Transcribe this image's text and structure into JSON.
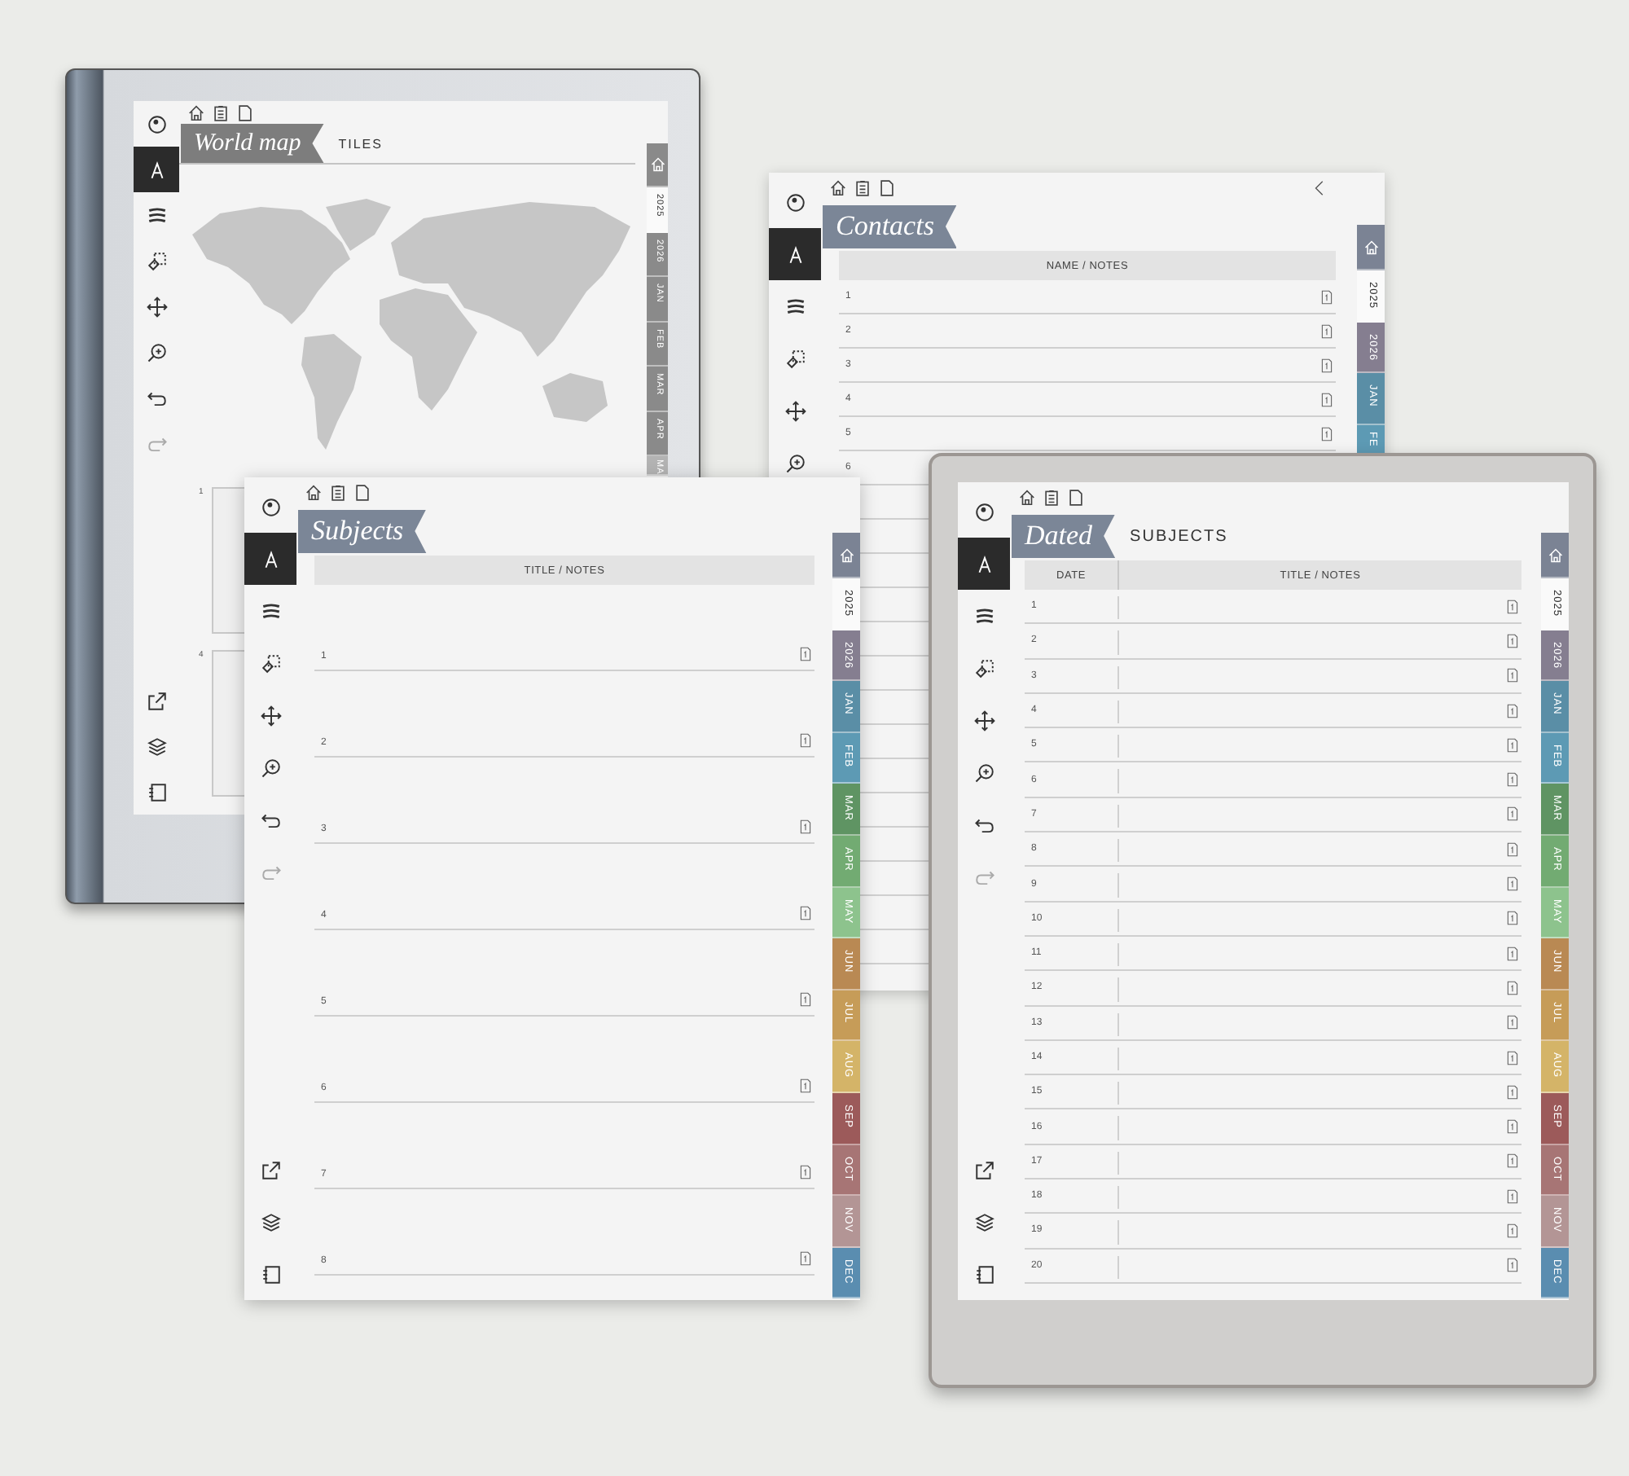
{
  "pages": [
    {
      "kind": "map",
      "title": "World map",
      "subtitle": "TILES",
      "tools": [
        {
          "kind": "dial",
          "selected": false
        },
        {
          "kind": "pen",
          "selected": true
        },
        {
          "kind": "lines",
          "selected": false
        },
        {
          "kind": "eraser",
          "selected": false
        },
        {
          "kind": "move",
          "selected": false
        },
        {
          "kind": "zoom",
          "selected": false
        },
        {
          "kind": "undo",
          "selected": false
        },
        {
          "kind": "redo",
          "selected": false
        }
      ],
      "bottom_tools": [
        {
          "kind": "export",
          "selected": false
        },
        {
          "kind": "layers",
          "selected": false
        },
        {
          "kind": "notebook",
          "selected": false
        }
      ],
      "tabs": [
        {
          "kind": "home",
          "selected": false,
          "color": "#8a8a8a"
        },
        {
          "kind": "label",
          "label": "2025",
          "selected": true,
          "color": "#333333"
        },
        {
          "kind": "label",
          "label": "2026",
          "selected": false,
          "color": "#8a8a8a"
        },
        {
          "kind": "label",
          "label": "JAN",
          "selected": false,
          "color": "#8a8a8a"
        },
        {
          "kind": "label",
          "label": "FEB",
          "selected": false,
          "color": "#8a8a8a"
        },
        {
          "kind": "label",
          "label": "MAR",
          "selected": false,
          "color": "#8a8a8a"
        },
        {
          "kind": "label",
          "label": "APR",
          "selected": false,
          "color": "#8a8a8a"
        },
        {
          "kind": "label",
          "label": "MA",
          "selected": false,
          "color": "#b3b3b3"
        }
      ],
      "tiles": [
        "1",
        "4"
      ]
    },
    {
      "kind": "contacts",
      "title": "Contacts",
      "tools": [
        {
          "kind": "dial",
          "selected": false
        },
        {
          "kind": "pen",
          "selected": true
        },
        {
          "kind": "lines",
          "selected": false
        },
        {
          "kind": "eraser",
          "selected": false
        },
        {
          "kind": "move",
          "selected": false
        },
        {
          "kind": "zoom",
          "selected": false
        }
      ],
      "tabs": [
        {
          "kind": "home",
          "selected": false,
          "color": "#7b8394"
        },
        {
          "kind": "label",
          "label": "2025",
          "selected": true,
          "color": "#333333"
        },
        {
          "kind": "label",
          "label": "2026",
          "selected": false,
          "color": "#857e90"
        },
        {
          "kind": "label",
          "label": "JAN",
          "selected": false,
          "color": "#5a8ea6"
        },
        {
          "kind": "label",
          "label": "FE",
          "selected": false,
          "color": "#5d9ab4"
        }
      ],
      "columns": [
        "NAME / NOTES"
      ],
      "rows": [
        {
          "number": "1",
          "note_icon": true
        },
        {
          "number": "2",
          "note_icon": true
        },
        {
          "number": "3",
          "note_icon": true
        },
        {
          "number": "4",
          "note_icon": true
        },
        {
          "number": "5",
          "note_icon": true
        },
        {
          "number": "6",
          "note_icon": false
        }
      ]
    },
    {
      "kind": "subjects",
      "title": "Subjects",
      "tools": [
        {
          "kind": "dial",
          "selected": false
        },
        {
          "kind": "pen",
          "selected": true
        },
        {
          "kind": "lines",
          "selected": false
        },
        {
          "kind": "eraser",
          "selected": false
        },
        {
          "kind": "move",
          "selected": false
        },
        {
          "kind": "zoom",
          "selected": false
        },
        {
          "kind": "undo",
          "selected": false
        },
        {
          "kind": "redo",
          "selected": false
        }
      ],
      "bottom_tools": [
        {
          "kind": "export",
          "selected": false
        },
        {
          "kind": "layers",
          "selected": false
        },
        {
          "kind": "notebook",
          "selected": false
        }
      ],
      "tabs": [
        {
          "kind": "home",
          "selected": false,
          "color": "#7b8394"
        },
        {
          "kind": "label",
          "label": "2025",
          "selected": true,
          "color": "#333333"
        },
        {
          "kind": "label",
          "label": "2026",
          "selected": false,
          "color": "#857e90"
        },
        {
          "kind": "label",
          "label": "JAN",
          "selected": false,
          "color": "#5a8ea6"
        },
        {
          "kind": "label",
          "label": "FEB",
          "selected": false,
          "color": "#5d9ab4"
        },
        {
          "kind": "label",
          "label": "MAR",
          "selected": false,
          "color": "#5f9463"
        },
        {
          "kind": "label",
          "label": "APR",
          "selected": false,
          "color": "#72ab72"
        },
        {
          "kind": "label",
          "label": "MAY",
          "selected": false,
          "color": "#8dc38d"
        },
        {
          "kind": "label",
          "label": "JUN",
          "selected": false,
          "color": "#b98953"
        },
        {
          "kind": "label",
          "label": "JUL",
          "selected": false,
          "color": "#c69c58"
        },
        {
          "kind": "label",
          "label": "AUG",
          "selected": false,
          "color": "#d4b468"
        },
        {
          "kind": "label",
          "label": "SEP",
          "selected": false,
          "color": "#9c5a5a"
        },
        {
          "kind": "label",
          "label": "OCT",
          "selected": false,
          "color": "#a77575"
        },
        {
          "kind": "label",
          "label": "NOV",
          "selected": false,
          "color": "#b39595"
        },
        {
          "kind": "label",
          "label": "DEC",
          "selected": false,
          "color": "#5a8db0"
        }
      ],
      "columns": [
        "TITLE / NOTES"
      ],
      "rows": [
        {
          "number": "1",
          "note_icon": true
        },
        {
          "number": "2",
          "note_icon": true
        },
        {
          "number": "3",
          "note_icon": true
        },
        {
          "number": "4",
          "note_icon": true
        },
        {
          "number": "5",
          "note_icon": true
        },
        {
          "number": "6",
          "note_icon": true
        },
        {
          "number": "7",
          "note_icon": true
        },
        {
          "number": "8",
          "note_icon": true
        }
      ]
    },
    {
      "kind": "dated",
      "title": "Dated",
      "subtitle": "SUBJECTS",
      "tools": [
        {
          "kind": "dial",
          "selected": false
        },
        {
          "kind": "pen",
          "selected": true
        },
        {
          "kind": "lines",
          "selected": false
        },
        {
          "kind": "eraser",
          "selected": false
        },
        {
          "kind": "move",
          "selected": false
        },
        {
          "kind": "zoom",
          "selected": false
        },
        {
          "kind": "undo",
          "selected": false
        },
        {
          "kind": "redo",
          "selected": false
        }
      ],
      "bottom_tools": [
        {
          "kind": "export",
          "selected": false
        },
        {
          "kind": "layers",
          "selected": false
        },
        {
          "kind": "notebook",
          "selected": false
        }
      ],
      "tabs": [
        {
          "kind": "home",
          "selected": false,
          "color": "#7b8394"
        },
        {
          "kind": "label",
          "label": "2025",
          "selected": true,
          "color": "#333333"
        },
        {
          "kind": "label",
          "label": "2026",
          "selected": false,
          "color": "#857e90"
        },
        {
          "kind": "label",
          "label": "JAN",
          "selected": false,
          "color": "#5a8ea6"
        },
        {
          "kind": "label",
          "label": "FEB",
          "selected": false,
          "color": "#5d9ab4"
        },
        {
          "kind": "label",
          "label": "MAR",
          "selected": false,
          "color": "#5f9463"
        },
        {
          "kind": "label",
          "label": "APR",
          "selected": false,
          "color": "#72ab72"
        },
        {
          "kind": "label",
          "label": "MAY",
          "selected": false,
          "color": "#8dc38d"
        },
        {
          "kind": "label",
          "label": "JUN",
          "selected": false,
          "color": "#b98953"
        },
        {
          "kind": "label",
          "label": "JUL",
          "selected": false,
          "color": "#c69c58"
        },
        {
          "kind": "label",
          "label": "AUG",
          "selected": false,
          "color": "#d4b468"
        },
        {
          "kind": "label",
          "label": "SEP",
          "selected": false,
          "color": "#9c5a5a"
        },
        {
          "kind": "label",
          "label": "OCT",
          "selected": false,
          "color": "#a77575"
        },
        {
          "kind": "label",
          "label": "NOV",
          "selected": false,
          "color": "#b39595"
        },
        {
          "kind": "label",
          "label": "DEC",
          "selected": false,
          "color": "#5a8db0"
        }
      ],
      "columns": [
        "DATE",
        "TITLE / NOTES"
      ],
      "rows": [
        {
          "number": "1",
          "note_icon": true
        },
        {
          "number": "2",
          "note_icon": true
        },
        {
          "number": "3",
          "note_icon": true
        },
        {
          "number": "4",
          "note_icon": true
        },
        {
          "number": "5",
          "note_icon": true
        },
        {
          "number": "6",
          "note_icon": true
        },
        {
          "number": "7",
          "note_icon": true
        },
        {
          "number": "8",
          "note_icon": true
        },
        {
          "number": "9",
          "note_icon": true
        },
        {
          "number": "10",
          "note_icon": true
        },
        {
          "number": "11",
          "note_icon": true
        },
        {
          "number": "12",
          "note_icon": true
        },
        {
          "number": "13",
          "note_icon": true
        },
        {
          "number": "14",
          "note_icon": true
        },
        {
          "number": "15",
          "note_icon": true
        },
        {
          "number": "16",
          "note_icon": true
        },
        {
          "number": "17",
          "note_icon": true
        },
        {
          "number": "18",
          "note_icon": true
        },
        {
          "number": "19",
          "note_icon": true
        },
        {
          "number": "20",
          "note_icon": true
        }
      ]
    }
  ]
}
